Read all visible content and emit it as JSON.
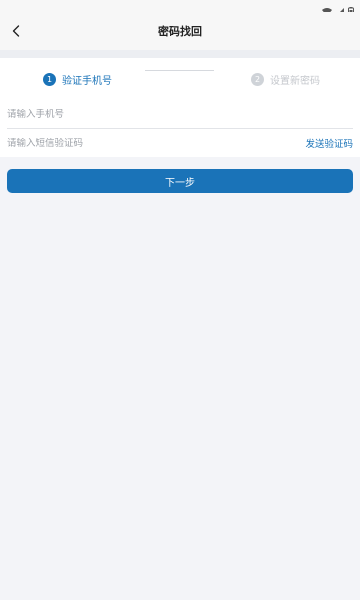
{
  "header": {
    "title": "密码找回"
  },
  "steps": [
    {
      "number": "1",
      "label": "验证手机号",
      "active": true
    },
    {
      "number": "2",
      "label": "设置新密码",
      "active": false
    }
  ],
  "form": {
    "phone_placeholder": "请输入手机号",
    "code_placeholder": "请输入短信验证码",
    "send_code_label": "发送验证码",
    "next_label": "下一步"
  },
  "colors": {
    "accent": "#1a73b8",
    "background": "#f3f4f8"
  },
  "icons": {
    "back": "chevron-left-icon",
    "wifi": "wifi-icon",
    "signal": "signal-icon",
    "battery": "battery-icon"
  }
}
